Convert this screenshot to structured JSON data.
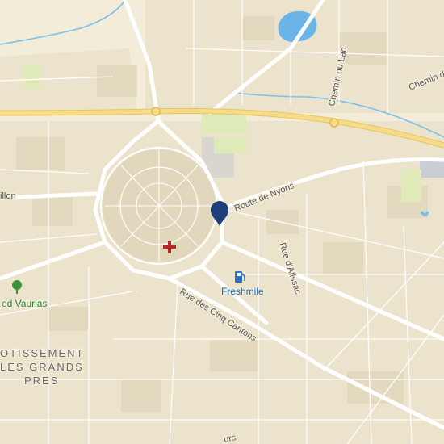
{
  "map": {
    "colors": {
      "land": "#f3ecd8",
      "urban": "#ebe3cc",
      "blocks": "#e2d8bd",
      "road": "#ffffff",
      "highway": "#f2cf6a",
      "water": "#6ab4e8",
      "park": "#d9e8b4",
      "marker": "#1f3f7a",
      "poi_red": "#b12a2a",
      "fuel": "#2c6fbf"
    },
    "labels": {
      "route_de_nyons": "Route de Nyons",
      "rue_des_cinq_cantons": "Rue des Cinq Cantons",
      "rue_d_alissac": "Rue d'Alissac",
      "chemin_du_lac": "Chemin du Lac",
      "chemin_de": "Chemin de",
      "route_west_fragment": "illon",
      "bottom_fragment": "urs",
      "place_green": "ed Vaurias",
      "lotissement_line1": "OTISSEMENT",
      "lotissement_line2": "LES GRANDS",
      "lotissement_line3": "PRES",
      "fuel_station": "Freshmile"
    },
    "icons": {
      "location_marker": "map-pin-icon",
      "medical": "hospital-cross-icon",
      "fuel": "fuel-pump-icon",
      "park": "tree-icon"
    }
  }
}
